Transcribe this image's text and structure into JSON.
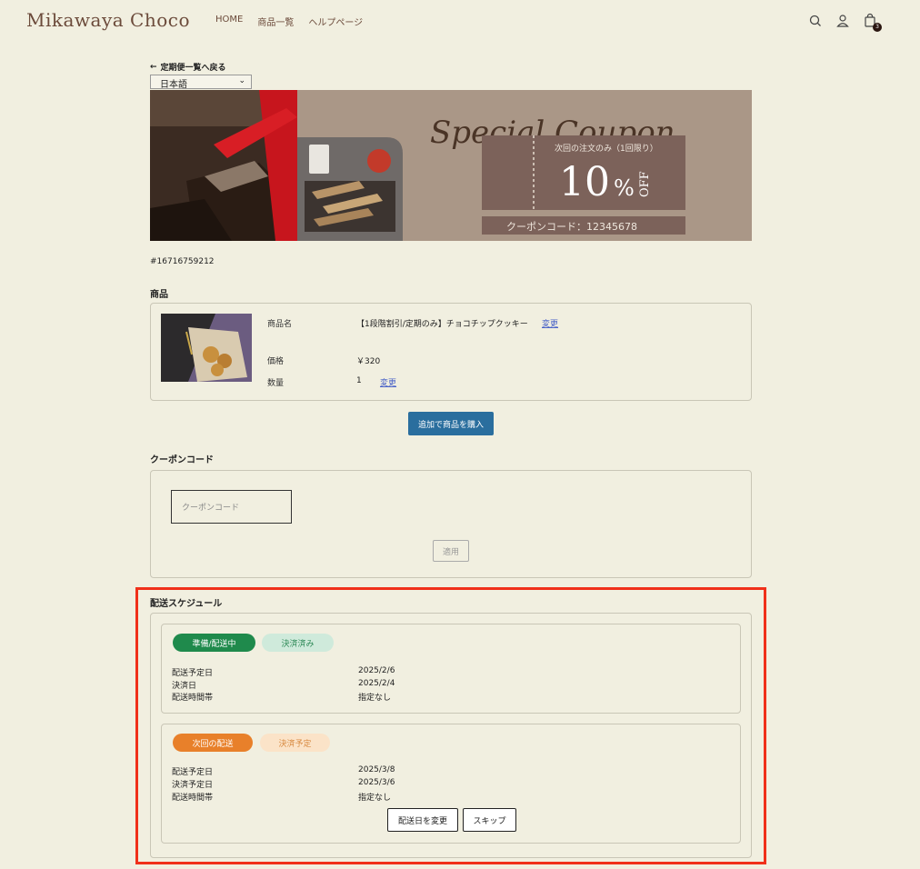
{
  "header": {
    "logo": "Mikawaya Choco",
    "nav": [
      "HOME",
      "商品一覧",
      "ヘルプページ"
    ],
    "cart_count": "3"
  },
  "back_link": "定期便一覧へ戻る",
  "language": "日本語",
  "banner": {
    "script_text": "Special Coupon",
    "note": "次回の注文のみ（1回限り）",
    "percent": "10",
    "percent_sign": "%",
    "off": "OFF",
    "code_text": "クーポンコード：12345678"
  },
  "order_id": "#16716759212",
  "product_section": {
    "title": "商品",
    "name_label": "商品名",
    "name_value": "【1段階割引/定期のみ】チョコチップクッキー",
    "price_label": "価格",
    "price_value": "￥320",
    "qty_label": "数量",
    "qty_value": "1",
    "change_label": "変更",
    "add_button": "追加で商品を購入"
  },
  "coupon_section": {
    "title": "クーポンコード",
    "placeholder": "クーポンコード",
    "apply_button": "適用"
  },
  "schedule_section": {
    "title": "配送スケジュール",
    "cards": [
      {
        "status": "準備/配送中",
        "payment": "決済済み",
        "rows": [
          {
            "label": "配送予定日",
            "value": "2025/2/6"
          },
          {
            "label": "決済日",
            "value": "2025/2/4"
          },
          {
            "label": "配送時間帯",
            "value": "指定なし"
          }
        ]
      },
      {
        "status": "次回の配送",
        "payment": "決済予定",
        "rows": [
          {
            "label": "配送予定日",
            "value": "2025/3/8"
          },
          {
            "label": "決済予定日",
            "value": "2025/3/6"
          },
          {
            "label": "配送時間帯",
            "value": "指定なし"
          }
        ],
        "change_date_button": "配送日を変更",
        "skip_button": "スキップ"
      }
    ]
  },
  "colors": {
    "background": "#f1efe0",
    "primary_button": "#2a6e9e",
    "status_green": "#1f8a4c",
    "payment_green_bg": "#cfeadb",
    "status_orange": "#e8802a",
    "payment_orange_bg": "#fbe3c8",
    "highlight": "#f0301a"
  }
}
